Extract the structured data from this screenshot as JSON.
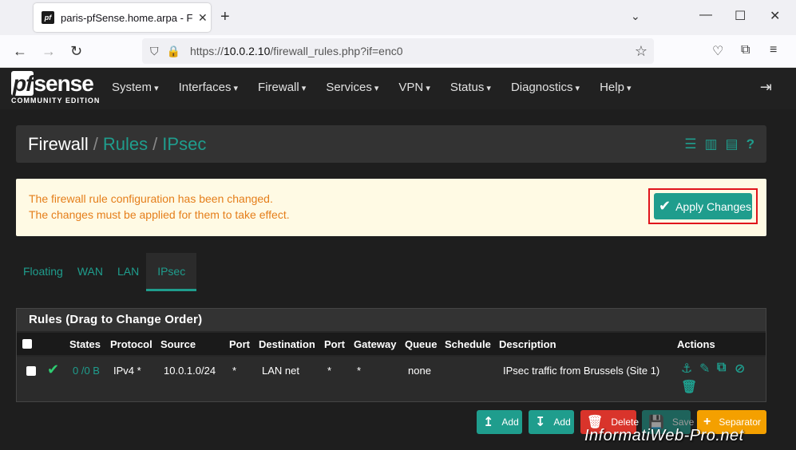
{
  "browser": {
    "tab_title": "paris-pfSense.home.arpa - Firewall",
    "favicon_text": "pf",
    "url_prefix": "https://",
    "url_host": "10.0.2.10",
    "url_path": "/firewall_rules.php?if=enc0"
  },
  "header": {
    "logo_main": "sense",
    "logo_pf": "pf",
    "logo_sub": "COMMUNITY EDITION",
    "menu": [
      "System",
      "Interfaces",
      "Firewall",
      "Services",
      "VPN",
      "Status",
      "Diagnostics",
      "Help"
    ]
  },
  "breadcrumb": {
    "root": "Firewall",
    "level1": "Rules",
    "level2": "IPsec"
  },
  "alert": {
    "line1": "The firewall rule configuration has been changed.",
    "line2": "The changes must be applied for them to take effect.",
    "apply_label": "Apply Changes"
  },
  "tabs": [
    "Floating",
    "WAN",
    "LAN",
    "IPsec"
  ],
  "active_tab": "IPsec",
  "rules_panel": {
    "title": "Rules (Drag to Change Order)",
    "columns": [
      "States",
      "Protocol",
      "Source",
      "Port",
      "Destination",
      "Port",
      "Gateway",
      "Queue",
      "Schedule",
      "Description",
      "Actions"
    ],
    "rows": [
      {
        "states": "0 /0 B",
        "protocol": "IPv4 *",
        "source": "10.0.1.0/24",
        "source_port": "*",
        "destination": "LAN net",
        "dest_port": "*",
        "gateway": "*",
        "queue": "none",
        "schedule": "",
        "description": "IPsec traffic from Brussels (Site 1)"
      }
    ]
  },
  "buttons": {
    "add_top": "Add",
    "add_bottom": "Add",
    "delete": "Delete",
    "save": "Save",
    "separator": "Separator"
  },
  "watermark": "InformatiWeb-Pro.net",
  "colors": {
    "accent": "#1f9d8d",
    "alert_bg": "#fffae4",
    "alert_text": "#e57e1a",
    "danger": "#d9342b",
    "warning": "#f4a000"
  }
}
